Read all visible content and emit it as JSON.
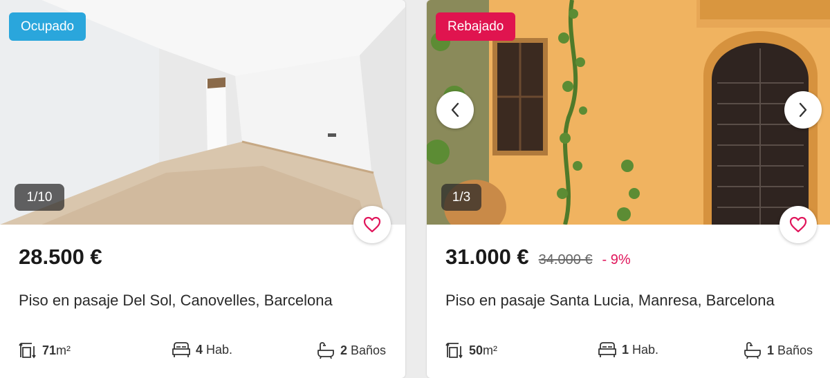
{
  "listings": [
    {
      "badge": "Ocupado",
      "badge_color": "#2aa6dc",
      "photo_counter": "1/10",
      "price": "28.500 €",
      "title": "Piso en pasaje Del Sol, Canovelles, Barcelona",
      "area_value": "71",
      "area_unit": "m²",
      "rooms_value": "4",
      "rooms_label": "Hab.",
      "baths_value": "2",
      "baths_label": "Baños"
    },
    {
      "badge": "Rebajado",
      "badge_color": "#e0144f",
      "photo_counter": "1/3",
      "price": "31.000 €",
      "old_price": "34.000 €",
      "discount": "- 9%",
      "title": "Piso en pasaje Santa Lucia, Manresa, Barcelona",
      "area_value": "50",
      "area_unit": "m²",
      "rooms_value": "1",
      "rooms_label": "Hab.",
      "baths_value": "1",
      "baths_label": "Baños"
    }
  ],
  "icons": {
    "favorite": "heart-icon",
    "prev": "chevron-left-icon",
    "next": "chevron-right-icon",
    "area": "area-icon",
    "rooms": "bed-icon",
    "baths": "bathtub-icon"
  },
  "colors": {
    "accent": "#e0145a",
    "discount": "#e0145a"
  }
}
